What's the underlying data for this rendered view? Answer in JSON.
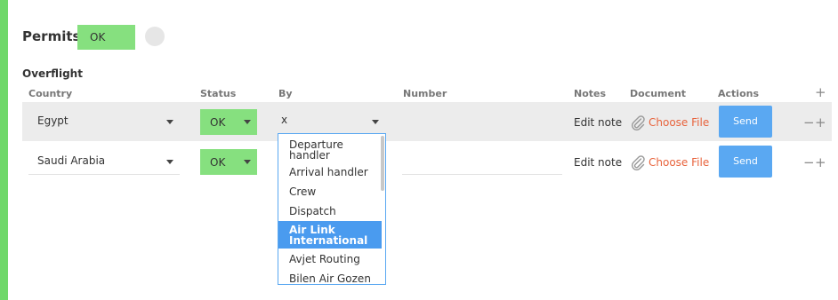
{
  "permits": {
    "title": "Permits",
    "status_badge": "OK"
  },
  "overflight": {
    "title": "Overflight",
    "columns": {
      "country": "Country",
      "status": "Status",
      "by": "By",
      "number": "Number",
      "notes": "Notes",
      "document": "Document",
      "actions": "Actions"
    },
    "add_symbol": "+",
    "remove_symbol": "−",
    "rows": [
      {
        "country": "Egypt",
        "status": "OK",
        "by": "x",
        "number": "",
        "notes": "Edit note",
        "document": "Choose File",
        "action": "Send"
      },
      {
        "country": "Saudi Arabia",
        "status": "OK",
        "by": "",
        "number": "",
        "notes": "Edit note",
        "document": "Choose File",
        "action": "Send"
      }
    ]
  },
  "by_dropdown": {
    "options": [
      "Departure handler",
      "Arrival handler",
      "Crew",
      "Dispatch",
      "Air Link International",
      "Avjet Routing",
      "Bilen Air Gozen"
    ],
    "highlighted": "Air Link International"
  },
  "colors": {
    "accent_green": "#6fd86a",
    "status_green": "#86e07f",
    "send_blue": "#5aa8f2",
    "link_orange": "#e8633c",
    "highlight_blue": "#4a9bef"
  },
  "icons": {
    "document": "paperclip-icon",
    "select": "caret-down-icon"
  }
}
